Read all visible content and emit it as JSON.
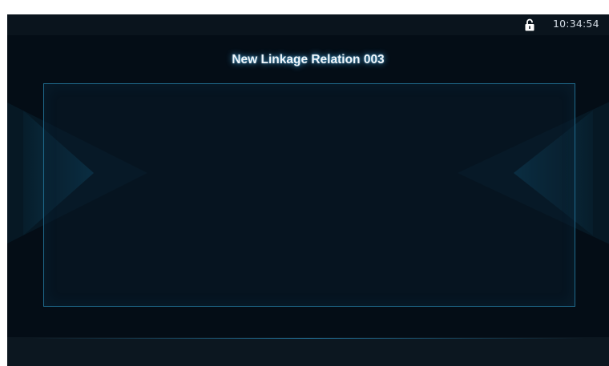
{
  "status_bar": {
    "time": "10:34:54",
    "lock_icon": "unlocked-padlock-icon"
  },
  "page": {
    "title": "New Linkage Relation 003"
  },
  "colors": {
    "background": "#040d16",
    "status_bar": "#0a141d",
    "panel_border": "#1f6a8c",
    "title_glow": "#50beff",
    "lock_icon": "#ffffff"
  }
}
